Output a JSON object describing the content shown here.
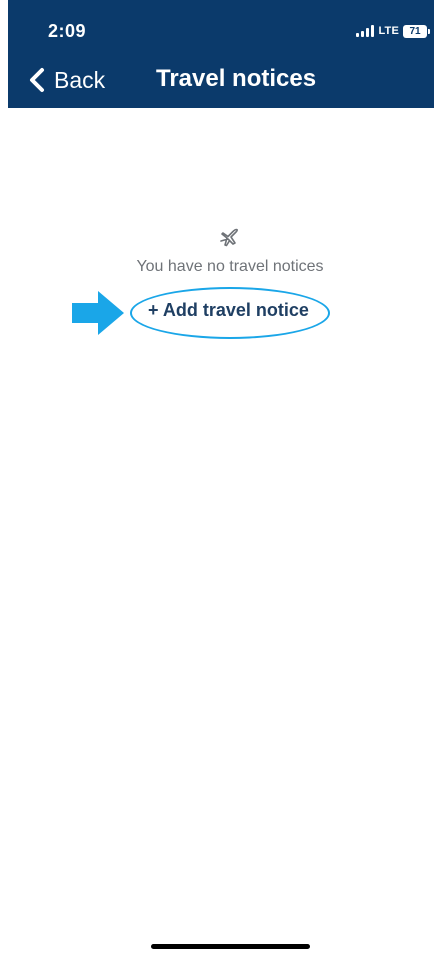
{
  "status_bar": {
    "time": "2:09",
    "network": "LTE",
    "battery": "71"
  },
  "nav": {
    "back_label": "Back",
    "title": "Travel notices"
  },
  "empty_state": {
    "icon": "airplane-icon",
    "message": "You have no travel notices",
    "add_label": "+ Add travel notice"
  },
  "annotation": {
    "arrow_color": "#1aa6e8",
    "ring_color": "#1aa6e8"
  },
  "colors": {
    "header": "#0b3a6b",
    "link": "#1f3f63"
  }
}
